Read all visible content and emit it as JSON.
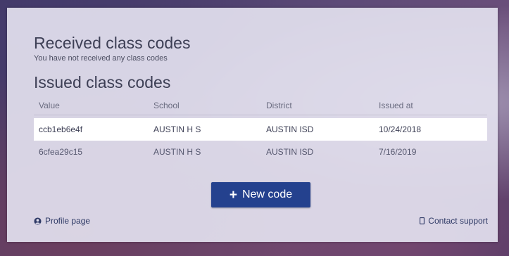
{
  "received": {
    "title": "Received class codes",
    "empty_message": "You have not received any class codes"
  },
  "issued": {
    "title": "Issued class codes",
    "columns": [
      "Value",
      "School",
      "District",
      "Issued at"
    ],
    "rows": [
      {
        "value": "ccb1eb6e4f",
        "school": "AUSTIN H S",
        "district": "AUSTIN ISD",
        "issued_at": "10/24/2018"
      },
      {
        "value": "6cfea29c15",
        "school": "AUSTIN H S",
        "district": "AUSTIN ISD",
        "issued_at": "7/16/2019"
      }
    ]
  },
  "actions": {
    "new_code_label": "New code",
    "new_code_icon": "plus-icon"
  },
  "footer": {
    "profile_label": "Profile page",
    "profile_icon": "user-circle-icon",
    "support_label": "Contact support",
    "support_icon": "phone-icon"
  },
  "colors": {
    "accent": "#24418e",
    "highlight_row": "#ffffff"
  }
}
